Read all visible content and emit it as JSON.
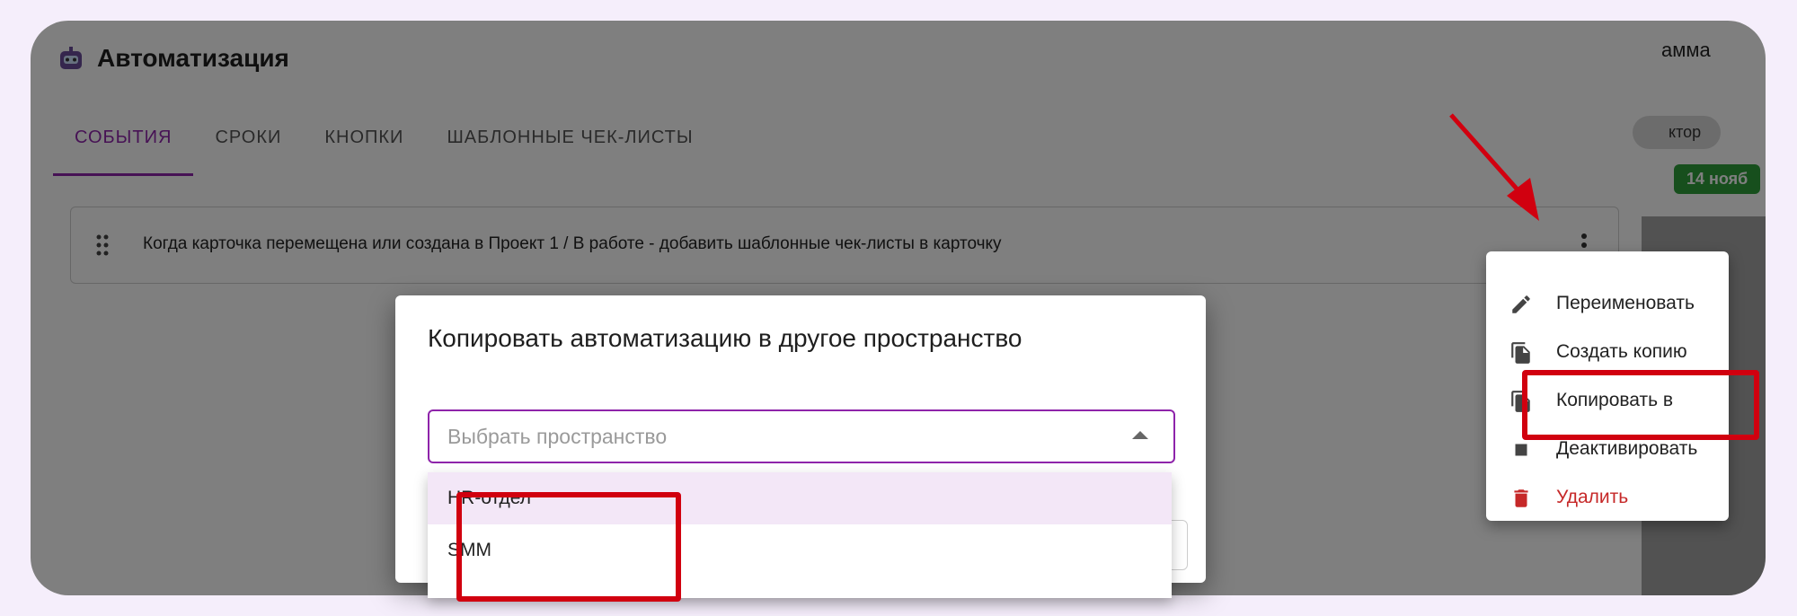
{
  "header": {
    "title": "Автоматизация"
  },
  "tabs": [
    {
      "label": "СОБЫТИЯ",
      "active": true
    },
    {
      "label": "СРОКИ"
    },
    {
      "label": "КНОПКИ"
    },
    {
      "label": "ШАБЛОННЫЕ ЧЕК-ЛИСТЫ"
    }
  ],
  "rule": {
    "text": "Когда карточка перемещена или создана в Проект 1 / В работе - добавить шаблонные чек-листы в карточку"
  },
  "background_right": {
    "partial_text": "амма",
    "chip": "ктор",
    "date": "14 нояб"
  },
  "dialog": {
    "title": "Копировать автоматизацию в другое пространство",
    "select_placeholder": "Выбрать пространство",
    "options": [
      "HR-отдел",
      "SMM"
    ]
  },
  "context_menu": {
    "items": [
      {
        "label": "Переименовать",
        "icon": "pencil-icon"
      },
      {
        "label": "Создать копию",
        "icon": "copy-icon"
      },
      {
        "label": "Копировать в",
        "icon": "copy-to-icon"
      },
      {
        "label": "Деактивировать",
        "icon": "stop-icon"
      },
      {
        "label": "Удалить",
        "icon": "trash-icon",
        "danger": true
      }
    ]
  },
  "colors": {
    "accent": "#8e24aa",
    "annotation_red": "#d1000f",
    "danger": "#c62828"
  }
}
